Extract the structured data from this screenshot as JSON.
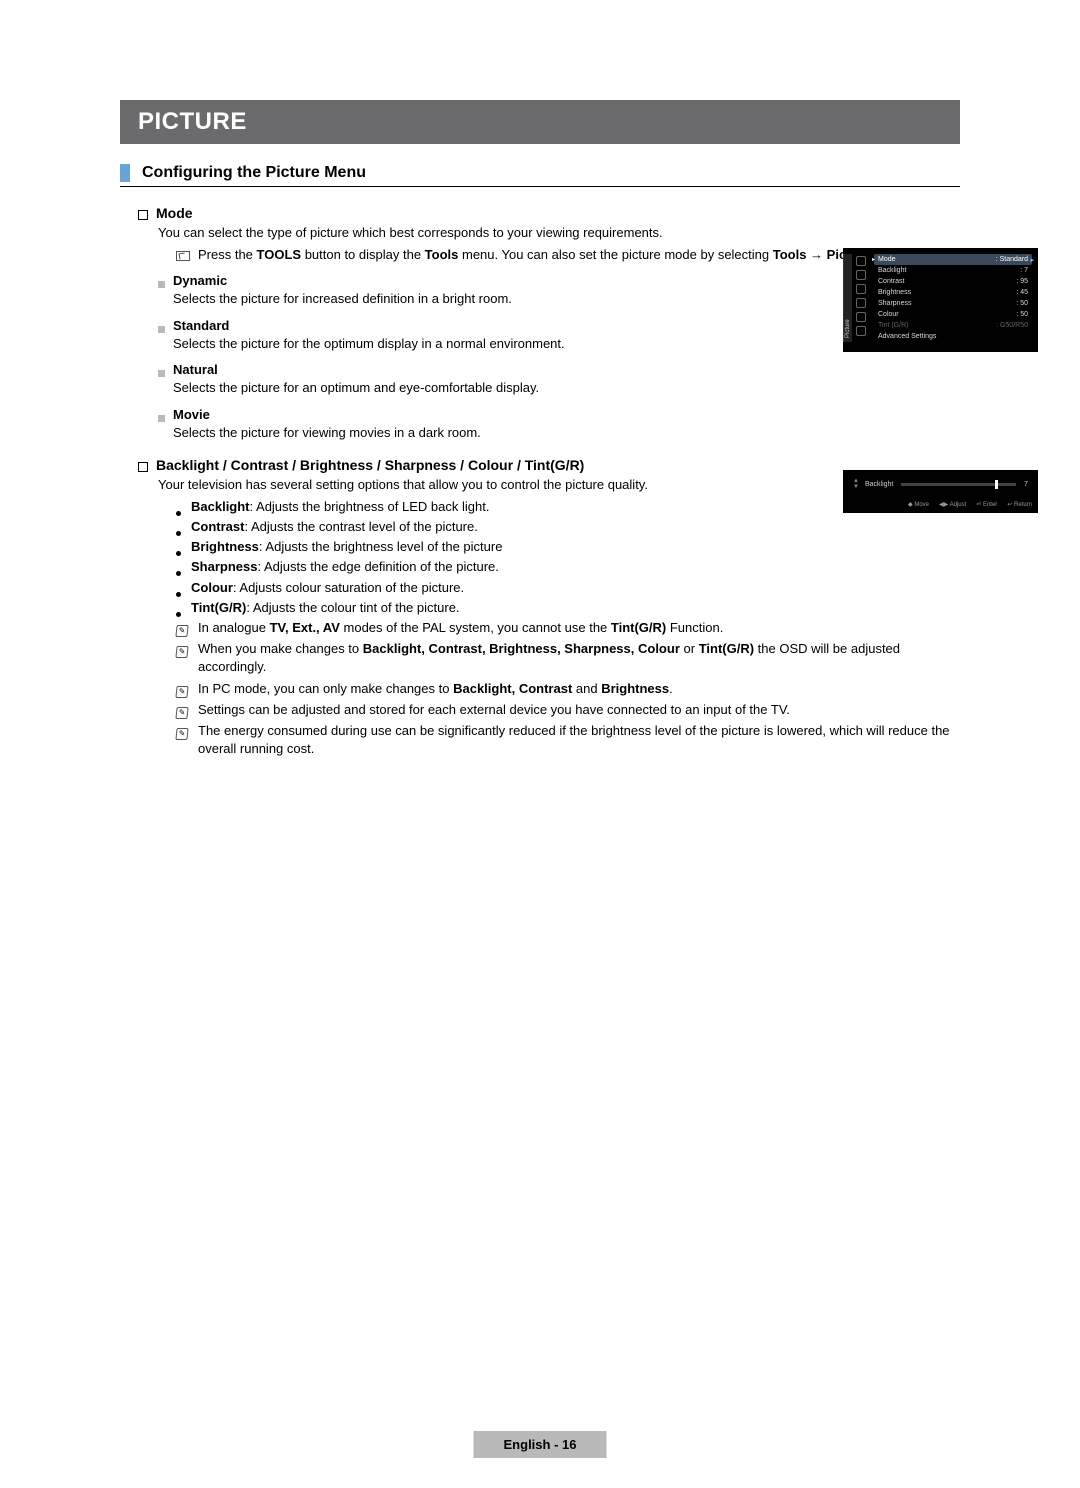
{
  "header": "PICTURE",
  "section_title": "Configuring the Picture Menu",
  "mode": {
    "heading": "Mode",
    "intro": "You can select the type of picture which best corresponds to your viewing requirements.",
    "tools_prefix": "Press the ",
    "tools_bold1": "TOOLS",
    "tools_mid1": " button to display the ",
    "tools_bold2": "Tools",
    "tools_mid2": " menu. You can also set the picture mode by selecting ",
    "tools_bold3": "Tools → Picture Mode",
    "tools_end": ".",
    "options": [
      {
        "name": "Dynamic",
        "desc": "Selects the picture for increased definition in a bright room."
      },
      {
        "name": "Standard",
        "desc": "Selects the picture for the optimum display in a normal environment."
      },
      {
        "name": "Natural",
        "desc": "Selects the picture for an optimum and eye-comfortable display."
      },
      {
        "name": "Movie",
        "desc": "Selects the picture for viewing movies in a dark room."
      }
    ]
  },
  "adjust": {
    "heading": "Backlight / Contrast / Brightness / Sharpness / Colour / Tint(G/R)",
    "intro": "Your television has several setting options that allow you to control the picture quality.",
    "bullets": [
      {
        "b": "Backlight",
        "t": ": Adjusts the brightness of LED back light."
      },
      {
        "b": "Contrast",
        "t": ": Adjusts the contrast level of the picture."
      },
      {
        "b": "Brightness",
        "t": ": Adjusts the brightness level of the picture"
      },
      {
        "b": "Sharpness",
        "t": ": Adjusts the edge definition of the picture."
      },
      {
        "b": "Colour",
        "t": ": Adjusts colour saturation of the picture."
      },
      {
        "b": "Tint(G/R)",
        "t": ": Adjusts the colour tint of the picture."
      }
    ],
    "note1_pre": "In analogue ",
    "note1_b1": "TV, Ext., AV",
    "note1_mid": " modes of the PAL system, you cannot use the ",
    "note1_b2": "Tint(G/R)",
    "note1_end": " Function.",
    "note2_pre": "When you make changes to ",
    "note2_b": "Backlight, Contrast, Brightness, Sharpness, Colour",
    "note2_mid": " or ",
    "note2_b2": "Tint(G/R)",
    "note2_end": " the OSD will be adjusted accordingly.",
    "note3_pre": "In PC mode, you can only make changes to ",
    "note3_b": "Backlight, Contrast",
    "note3_mid": " and ",
    "note3_b2": "Brightness",
    "note3_end": ".",
    "note4": "Settings can be adjusted and stored for each external device you have connected to an input of the TV.",
    "note5": "The energy consumed during use can be significantly reduced if the brightness level of the picture is lowered, which will reduce the overall running cost."
  },
  "osd": {
    "tab": "Picture",
    "rows": [
      {
        "label": "Mode",
        "value": ": Standard",
        "sel": true
      },
      {
        "label": "Backlight",
        "value": ": 7"
      },
      {
        "label": "Contrast",
        "value": ": 95"
      },
      {
        "label": "Brightness",
        "value": ": 45"
      },
      {
        "label": "Sharpness",
        "value": ": 50"
      },
      {
        "label": "Colour",
        "value": ": 50"
      },
      {
        "label": "Tint (G/R)",
        "value": ": G50/R50",
        "dim": true
      },
      {
        "label": "Advanced Settings",
        "value": ""
      }
    ]
  },
  "slider": {
    "label": "Backlight",
    "value": "7",
    "hints": [
      "◆ Move",
      "◀▶ Adjust",
      "⏎ Enter",
      "↩ Return"
    ]
  },
  "footer": "English - 16"
}
